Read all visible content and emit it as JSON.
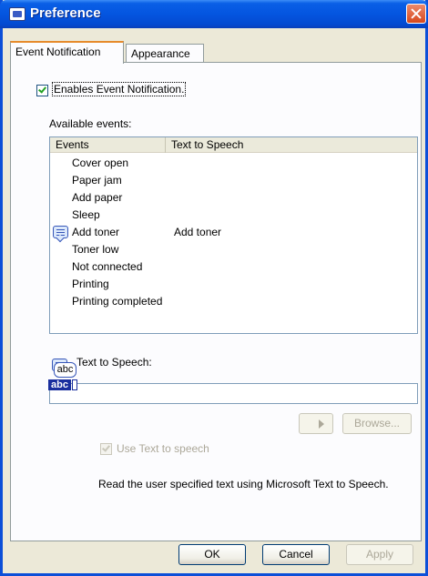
{
  "window": {
    "title": "Preference"
  },
  "tabs": [
    {
      "label": "Event Notification",
      "active": true
    },
    {
      "label": "Appearance",
      "active": false
    }
  ],
  "enable_checkbox": {
    "label": "Enables Event Notification.",
    "checked": true
  },
  "available_events_label": "Available events:",
  "event_list": {
    "columns": [
      "Events",
      "Text to Speech"
    ],
    "rows": [
      {
        "event": "Cover open",
        "tts": ""
      },
      {
        "event": "Paper jam",
        "tts": ""
      },
      {
        "event": "Add paper",
        "tts": ""
      },
      {
        "event": "Sleep",
        "tts": ""
      },
      {
        "event": "Add toner",
        "tts": "Add toner",
        "icon": "speech-bubble-icon"
      },
      {
        "event": "Toner low",
        "tts": ""
      },
      {
        "event": "Not connected",
        "tts": ""
      },
      {
        "event": "Printing",
        "tts": ""
      },
      {
        "event": "Printing completed",
        "tts": ""
      }
    ]
  },
  "tts_section": {
    "label": "Text to Speech:",
    "value": "",
    "play_label": "",
    "browse_label": "Browse...",
    "use_tts_label": "Use Text to speech",
    "use_tts_checked": true,
    "use_tts_enabled": false,
    "icon_top_text": "abc",
    "icon_bottom_text": "abc",
    "description": "Read the user specified text using Microsoft Text to Speech."
  },
  "footer": {
    "ok_label": "OK",
    "cancel_label": "Cancel",
    "apply_label": "Apply"
  },
  "colors": {
    "title_bar": "#0455e0",
    "dialog_bg": "#ece9d8",
    "panel_bg": "#fcfcfe",
    "close_button": "#d7481c",
    "tab_highlight": "#e68b2c"
  }
}
